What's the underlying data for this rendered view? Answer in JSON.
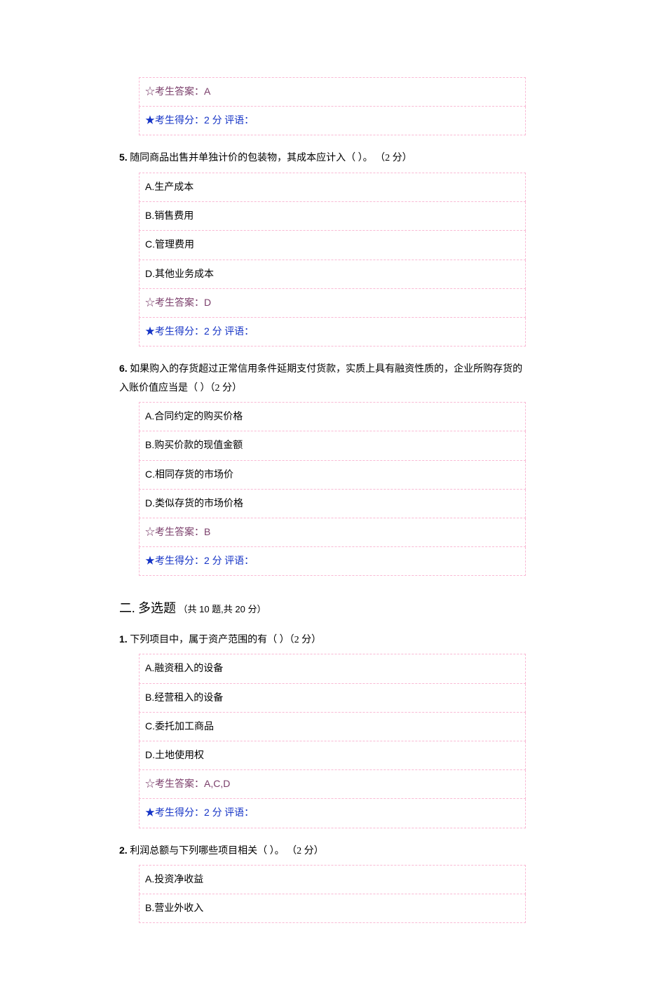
{
  "q4": {
    "ans_label": "☆考生答案：",
    "ans_value": "A",
    "score_label": "★考生得分：",
    "score_value": "2 分",
    "comment_label": "评语："
  },
  "q5": {
    "num": "5.",
    "text": "随同商品出售并单独计价的包装物，其成本应计入（  ）。 （2 分）",
    "opts": {
      "a": "A.生产成本",
      "b": "B.销售费用",
      "c": "C.管理费用",
      "d": "D.其他业务成本"
    },
    "ans_label": "☆考生答案：",
    "ans_value": "D",
    "score_label": "★考生得分：",
    "score_value": "2 分",
    "comment_label": "评语："
  },
  "q6": {
    "num": "6.",
    "text": "如果购入的存货超过正常信用条件延期支付货款，实质上具有融资性质的，企业所购存货的入账价值应当是（    ）（2 分）",
    "opts": {
      "a": "A.合同约定的购买价格",
      "b": "B.购买价款的现值金额",
      "c": "C.相同存货的市场价",
      "d": "D.类似存货的市场价格"
    },
    "ans_label": "☆考生答案：",
    "ans_value": "B",
    "score_label": "★考生得分：",
    "score_value": "2 分",
    "comment_label": "评语："
  },
  "section2": {
    "main": "二. 多选题",
    "sub": "（共 10 题,共 20 分）"
  },
  "m1": {
    "num": "1.",
    "text": "下列项目中，属于资产范围的有（    ）（2 分）",
    "opts": {
      "a": "A.融资租入的设备",
      "b": "B.经营租入的设备",
      "c": "C.委托加工商品",
      "d": "D.土地使用权"
    },
    "ans_label": "☆考生答案：",
    "ans_value": "A,C,D",
    "score_label": "★考生得分：",
    "score_value": "2 分",
    "comment_label": "评语："
  },
  "m2": {
    "num": "2.",
    "text": "利润总额与下列哪些项目相关（  ）。 （2 分）",
    "opts": {
      "a": "A.投资净收益",
      "b": "B.营业外收入"
    }
  }
}
